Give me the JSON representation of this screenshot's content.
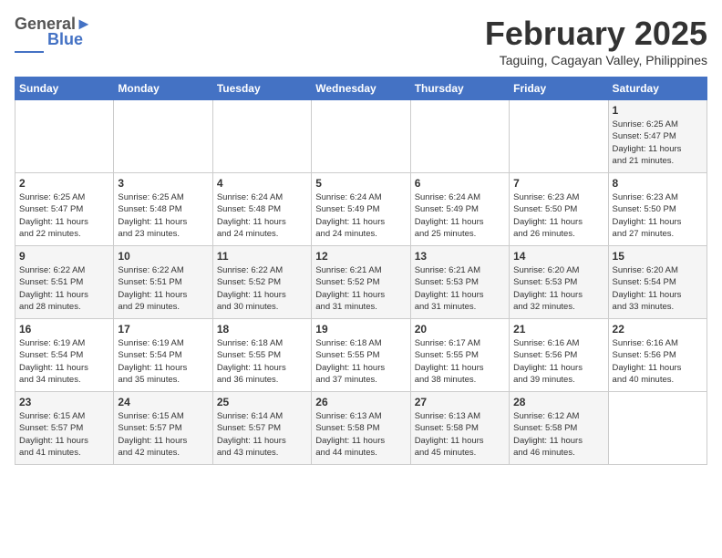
{
  "header": {
    "logo_general": "General",
    "logo_blue": "Blue",
    "month_title": "February 2025",
    "location": "Taguing, Cagayan Valley, Philippines"
  },
  "days_of_week": [
    "Sunday",
    "Monday",
    "Tuesday",
    "Wednesday",
    "Thursday",
    "Friday",
    "Saturday"
  ],
  "weeks": [
    [
      {
        "day": "",
        "info": ""
      },
      {
        "day": "",
        "info": ""
      },
      {
        "day": "",
        "info": ""
      },
      {
        "day": "",
        "info": ""
      },
      {
        "day": "",
        "info": ""
      },
      {
        "day": "",
        "info": ""
      },
      {
        "day": "1",
        "info": "Sunrise: 6:25 AM\nSunset: 5:47 PM\nDaylight: 11 hours\nand 21 minutes."
      }
    ],
    [
      {
        "day": "2",
        "info": "Sunrise: 6:25 AM\nSunset: 5:47 PM\nDaylight: 11 hours\nand 22 minutes."
      },
      {
        "day": "3",
        "info": "Sunrise: 6:25 AM\nSunset: 5:48 PM\nDaylight: 11 hours\nand 23 minutes."
      },
      {
        "day": "4",
        "info": "Sunrise: 6:24 AM\nSunset: 5:48 PM\nDaylight: 11 hours\nand 24 minutes."
      },
      {
        "day": "5",
        "info": "Sunrise: 6:24 AM\nSunset: 5:49 PM\nDaylight: 11 hours\nand 24 minutes."
      },
      {
        "day": "6",
        "info": "Sunrise: 6:24 AM\nSunset: 5:49 PM\nDaylight: 11 hours\nand 25 minutes."
      },
      {
        "day": "7",
        "info": "Sunrise: 6:23 AM\nSunset: 5:50 PM\nDaylight: 11 hours\nand 26 minutes."
      },
      {
        "day": "8",
        "info": "Sunrise: 6:23 AM\nSunset: 5:50 PM\nDaylight: 11 hours\nand 27 minutes."
      }
    ],
    [
      {
        "day": "9",
        "info": "Sunrise: 6:22 AM\nSunset: 5:51 PM\nDaylight: 11 hours\nand 28 minutes."
      },
      {
        "day": "10",
        "info": "Sunrise: 6:22 AM\nSunset: 5:51 PM\nDaylight: 11 hours\nand 29 minutes."
      },
      {
        "day": "11",
        "info": "Sunrise: 6:22 AM\nSunset: 5:52 PM\nDaylight: 11 hours\nand 30 minutes."
      },
      {
        "day": "12",
        "info": "Sunrise: 6:21 AM\nSunset: 5:52 PM\nDaylight: 11 hours\nand 31 minutes."
      },
      {
        "day": "13",
        "info": "Sunrise: 6:21 AM\nSunset: 5:53 PM\nDaylight: 11 hours\nand 31 minutes."
      },
      {
        "day": "14",
        "info": "Sunrise: 6:20 AM\nSunset: 5:53 PM\nDaylight: 11 hours\nand 32 minutes."
      },
      {
        "day": "15",
        "info": "Sunrise: 6:20 AM\nSunset: 5:54 PM\nDaylight: 11 hours\nand 33 minutes."
      }
    ],
    [
      {
        "day": "16",
        "info": "Sunrise: 6:19 AM\nSunset: 5:54 PM\nDaylight: 11 hours\nand 34 minutes."
      },
      {
        "day": "17",
        "info": "Sunrise: 6:19 AM\nSunset: 5:54 PM\nDaylight: 11 hours\nand 35 minutes."
      },
      {
        "day": "18",
        "info": "Sunrise: 6:18 AM\nSunset: 5:55 PM\nDaylight: 11 hours\nand 36 minutes."
      },
      {
        "day": "19",
        "info": "Sunrise: 6:18 AM\nSunset: 5:55 PM\nDaylight: 11 hours\nand 37 minutes."
      },
      {
        "day": "20",
        "info": "Sunrise: 6:17 AM\nSunset: 5:55 PM\nDaylight: 11 hours\nand 38 minutes."
      },
      {
        "day": "21",
        "info": "Sunrise: 6:16 AM\nSunset: 5:56 PM\nDaylight: 11 hours\nand 39 minutes."
      },
      {
        "day": "22",
        "info": "Sunrise: 6:16 AM\nSunset: 5:56 PM\nDaylight: 11 hours\nand 40 minutes."
      }
    ],
    [
      {
        "day": "23",
        "info": "Sunrise: 6:15 AM\nSunset: 5:57 PM\nDaylight: 11 hours\nand 41 minutes."
      },
      {
        "day": "24",
        "info": "Sunrise: 6:15 AM\nSunset: 5:57 PM\nDaylight: 11 hours\nand 42 minutes."
      },
      {
        "day": "25",
        "info": "Sunrise: 6:14 AM\nSunset: 5:57 PM\nDaylight: 11 hours\nand 43 minutes."
      },
      {
        "day": "26",
        "info": "Sunrise: 6:13 AM\nSunset: 5:58 PM\nDaylight: 11 hours\nand 44 minutes."
      },
      {
        "day": "27",
        "info": "Sunrise: 6:13 AM\nSunset: 5:58 PM\nDaylight: 11 hours\nand 45 minutes."
      },
      {
        "day": "28",
        "info": "Sunrise: 6:12 AM\nSunset: 5:58 PM\nDaylight: 11 hours\nand 46 minutes."
      },
      {
        "day": "",
        "info": ""
      }
    ]
  ]
}
